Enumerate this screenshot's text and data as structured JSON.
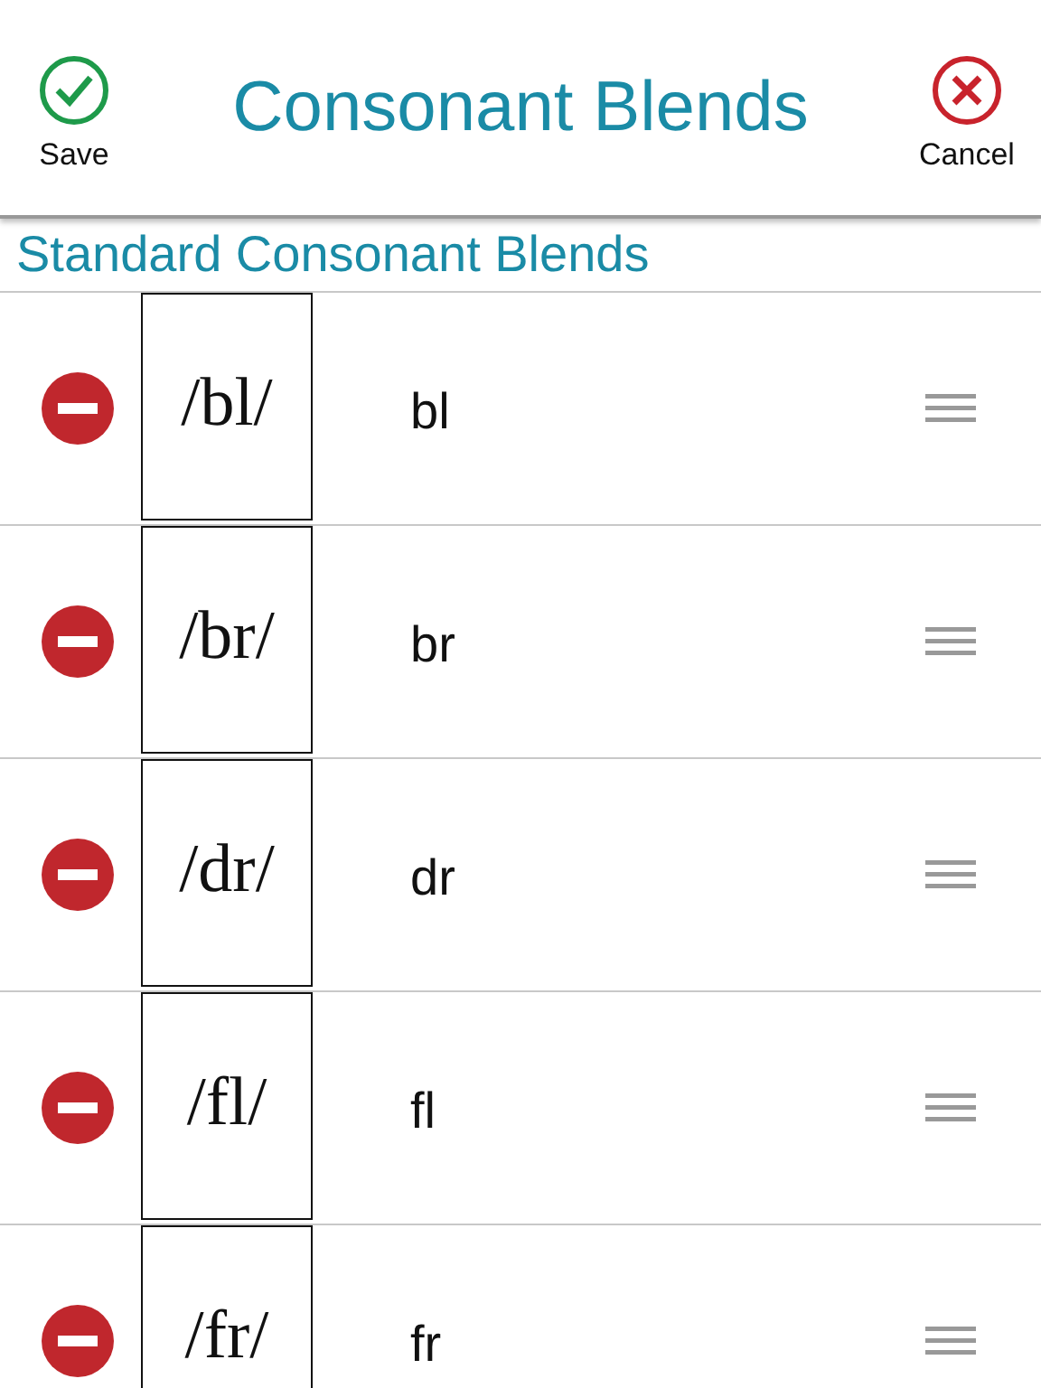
{
  "header": {
    "save_label": "Save",
    "title": "Consonant Blends",
    "cancel_label": "Cancel"
  },
  "section_title": "Standard Consonant Blends",
  "rows": [
    {
      "symbol": "/bl/",
      "letters": "bl"
    },
    {
      "symbol": "/br/",
      "letters": "br"
    },
    {
      "symbol": "/dr/",
      "letters": "dr"
    },
    {
      "symbol": "/fl/",
      "letters": "fl"
    },
    {
      "symbol": "/fr/",
      "letters": "fr"
    }
  ]
}
